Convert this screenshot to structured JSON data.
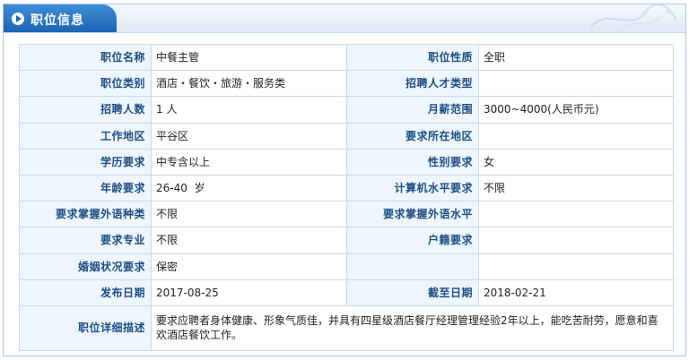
{
  "header": {
    "title": "职位信息"
  },
  "fields": {
    "job_name": {
      "label": "职位名称",
      "value": "中餐主管"
    },
    "job_nature": {
      "label": "职位性质",
      "value": "全职"
    },
    "job_category": {
      "label": "职位类别",
      "value": "酒店・餐饮・旅游・服务类"
    },
    "talent_type": {
      "label": "招聘人才类型",
      "value": ""
    },
    "headcount": {
      "label": "招聘人数",
      "value": "1 人"
    },
    "salary_range": {
      "label": "月薪范围",
      "value": "3000~4000(人民币元)"
    },
    "work_area": {
      "label": "工作地区",
      "value": "平谷区"
    },
    "required_location": {
      "label": "要求所在地区",
      "value": ""
    },
    "education": {
      "label": "学历要求",
      "value": "中专含以上"
    },
    "gender": {
      "label": "性别要求",
      "value": "女"
    },
    "age": {
      "label": "年龄要求",
      "value": "26-40  岁"
    },
    "computer_level": {
      "label": "计算机水平要求",
      "value": "不限"
    },
    "foreign_language_type": {
      "label": "要求掌握外语种类",
      "value": "不限"
    },
    "foreign_language_level": {
      "label": "要求掌握外语水平",
      "value": ""
    },
    "major": {
      "label": "要求专业",
      "value": "不限"
    },
    "household_registration": {
      "label": "户籍要求",
      "value": ""
    },
    "marital_status": {
      "label": "婚姻状况要求",
      "value": "保密"
    },
    "marital_status_right": {
      "label": "",
      "value": ""
    },
    "publish_date": {
      "label": "发布日期",
      "value": "2017-08-25"
    },
    "deadline": {
      "label": "截至日期",
      "value": "2018-02-21"
    },
    "job_description": {
      "label": "职位详细描述",
      "value": "要求应聘者身体健康、形象气质佳，并具有四星级酒店餐厅经理管理经验2年以上，能吃苦耐劳，愿意和喜欢酒店餐饮工作。"
    }
  }
}
